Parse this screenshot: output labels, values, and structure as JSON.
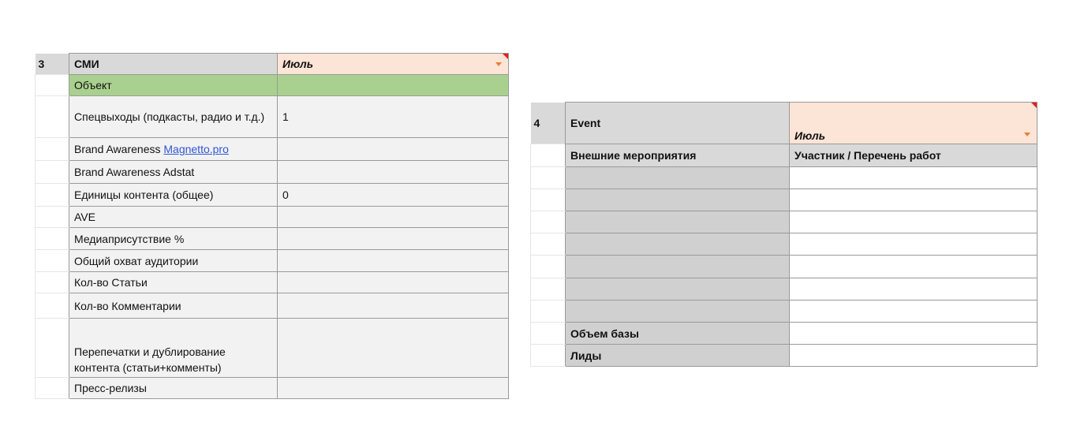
{
  "left_table": {
    "index": "3",
    "header_label": "СМИ",
    "month_value": "Июль",
    "rows": [
      {
        "label": "Объект",
        "value": ""
      },
      {
        "label": "Спецвыходы (подкасты, радио и т.д.)",
        "value": "1"
      },
      {
        "label_prefix": "Brand Awareness ",
        "link_text": "Magnetto.pro",
        "value": ""
      },
      {
        "label": "Brand Awareness Adstat",
        "value": ""
      },
      {
        "label": "Единицы контента (общее)",
        "value": "0"
      },
      {
        "label": "AVE",
        "value": ""
      },
      {
        "label": "Медиаприсутствие %",
        "value": ""
      },
      {
        "label": "Общий охват аудитории",
        "value": ""
      },
      {
        "label": "Кол-во Статьи",
        "value": ""
      },
      {
        "label": "Кол-во Комментарии",
        "value": ""
      },
      {
        "label": "Перепечатки и дублирование контента (статьи+комменты)",
        "value": ""
      },
      {
        "label": "Пресс-релизы",
        "value": ""
      }
    ]
  },
  "right_table": {
    "index": "4",
    "header_label": "Event",
    "month_value": "Июль",
    "col_headers": [
      "Внешние мероприятия",
      "Участник / Перечень работ"
    ],
    "footer_rows": [
      {
        "label": "Объем базы",
        "value": ""
      },
      {
        "label": "Лиды",
        "value": ""
      }
    ]
  },
  "colors": {
    "header_grey": "#d9d9d9",
    "month_peach": "#fce4d6",
    "object_green": "#a9d08e",
    "link_blue": "#2f55d4",
    "dropdown_orange": "#e6822e",
    "comment_red": "#e02020"
  }
}
